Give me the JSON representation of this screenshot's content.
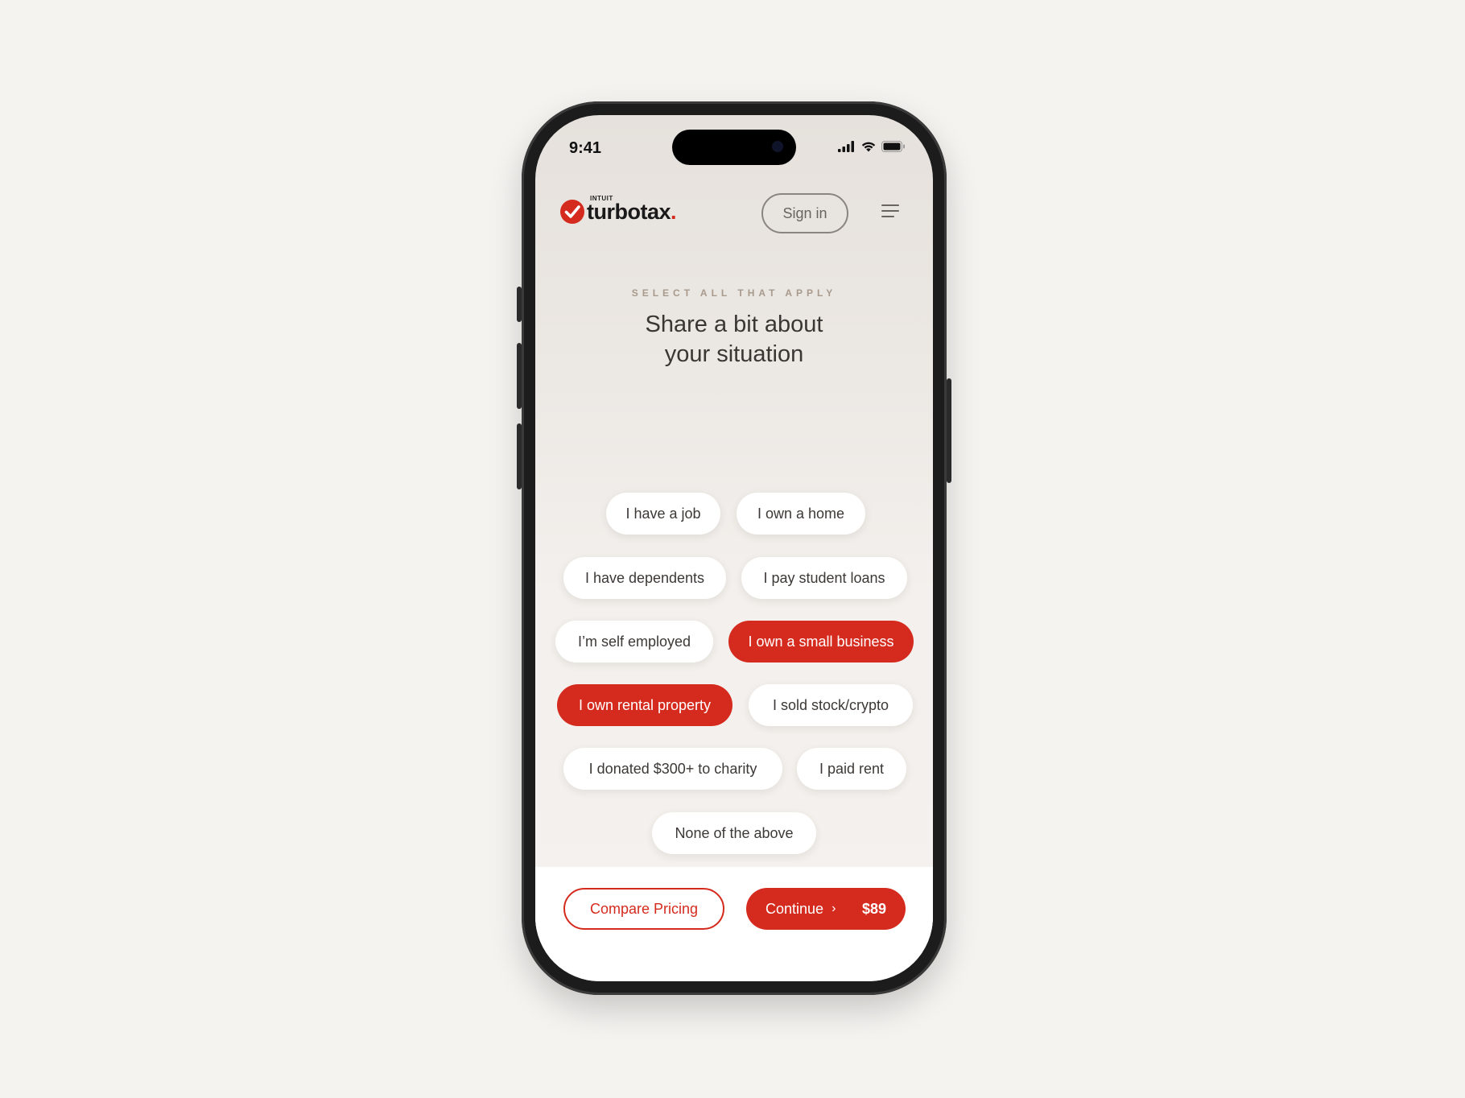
{
  "status_bar": {
    "time": "9:41",
    "icons": [
      "signal-icon",
      "wifi-icon",
      "battery-icon"
    ]
  },
  "header": {
    "logo_small": "INTUIT",
    "logo_word": "turbotax",
    "logo_dot": ".",
    "sign_in_label": "Sign in",
    "menu_icon": "hamburger-menu-icon"
  },
  "main": {
    "eyebrow": "SELECT ALL THAT APPLY",
    "headline_line1": "Share a bit about",
    "headline_line2": "your situation",
    "options": [
      {
        "label": "I have a job",
        "selected": false
      },
      {
        "label": "I own a home",
        "selected": false
      },
      {
        "label": "I have dependents",
        "selected": false
      },
      {
        "label": "I pay student loans",
        "selected": false
      },
      {
        "label": "I’m self employed",
        "selected": false
      },
      {
        "label": "I own a small business",
        "selected": true
      },
      {
        "label": "I own rental property",
        "selected": true
      },
      {
        "label": "I sold stock/crypto",
        "selected": false
      },
      {
        "label": "I donated $300+ to charity",
        "selected": false
      },
      {
        "label": "I paid rent",
        "selected": false
      },
      {
        "label": "None of the above",
        "selected": false
      }
    ]
  },
  "footer": {
    "compare_label": "Compare Pricing",
    "continue_label": "Continue",
    "continue_chevron": "›",
    "price": "$89"
  },
  "colors": {
    "brand_red": "#d52b1e",
    "page_background": "#f5f3f0",
    "text_dark": "#3a3633",
    "eyebrow": "#a89a8c"
  }
}
